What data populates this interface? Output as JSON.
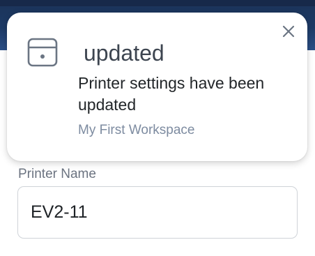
{
  "header": {
    "color": "#1d3a66"
  },
  "toast": {
    "icon": "printer-icon",
    "title": "updated",
    "message": "Printer settings have been updated",
    "workspace": "My First Workspace",
    "close_icon": "close-icon"
  },
  "form": {
    "printer_name_label": "Printer Name",
    "printer_name_value": "EV2-11"
  }
}
